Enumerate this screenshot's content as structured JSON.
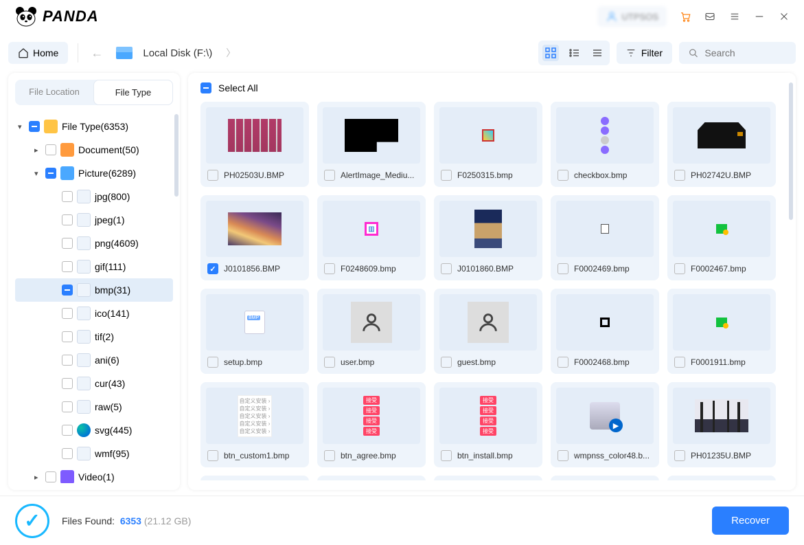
{
  "app": {
    "name": "PANDA",
    "account": "UTPSOS"
  },
  "nav": {
    "home": "Home",
    "crumb": "Local Disk (F:\\)",
    "filter": "Filter",
    "search_ph": "Search"
  },
  "tabs": {
    "loc": "File Location",
    "type": "File Type"
  },
  "tree": [
    {
      "d": 0,
      "exp": "▾",
      "cb": "blue",
      "ico": "folder",
      "label": "File Type(6353)"
    },
    {
      "d": 1,
      "exp": "▸",
      "cb": "",
      "ico": "doc",
      "label": "Document(50)"
    },
    {
      "d": 1,
      "exp": "▾",
      "cb": "blue",
      "ico": "pic",
      "label": "Picture(6289)"
    },
    {
      "d": 2,
      "exp": "",
      "cb": "",
      "ico": "file",
      "label": "jpg(800)"
    },
    {
      "d": 2,
      "exp": "",
      "cb": "",
      "ico": "file",
      "label": "jpeg(1)"
    },
    {
      "d": 2,
      "exp": "",
      "cb": "",
      "ico": "file",
      "label": "png(4609)"
    },
    {
      "d": 2,
      "exp": "",
      "cb": "",
      "ico": "file",
      "label": "gif(111)"
    },
    {
      "d": 2,
      "exp": "",
      "cb": "blue",
      "ico": "file",
      "label": "bmp(31)",
      "sel": true
    },
    {
      "d": 2,
      "exp": "",
      "cb": "",
      "ico": "file",
      "label": "ico(141)"
    },
    {
      "d": 2,
      "exp": "",
      "cb": "",
      "ico": "file",
      "label": "tif(2)"
    },
    {
      "d": 2,
      "exp": "",
      "cb": "",
      "ico": "file",
      "label": "ani(6)"
    },
    {
      "d": 2,
      "exp": "",
      "cb": "",
      "ico": "file",
      "label": "cur(43)"
    },
    {
      "d": 2,
      "exp": "",
      "cb": "",
      "ico": "file",
      "label": "raw(5)"
    },
    {
      "d": 2,
      "exp": "",
      "cb": "",
      "ico": "edge",
      "label": "svg(445)"
    },
    {
      "d": 2,
      "exp": "",
      "cb": "",
      "ico": "file",
      "label": "wmf(95)"
    },
    {
      "d": 1,
      "exp": "▸",
      "cb": "",
      "ico": "vid",
      "label": "Video(1)"
    }
  ],
  "select_all": "Select All",
  "files": [
    {
      "name": "PH02503U.BMP",
      "ck": "",
      "thumb": "buildings"
    },
    {
      "name": "AlertImage_Mediu...",
      "ck": "",
      "thumb": "black"
    },
    {
      "name": "F0250315.bmp",
      "ck": "",
      "thumb": "badge"
    },
    {
      "name": "checkbox.bmp",
      "ck": "",
      "thumb": "dots"
    },
    {
      "name": "PH02742U.BMP",
      "ck": "",
      "thumb": "bag"
    },
    {
      "name": "J0101856.BMP",
      "ck": "checked",
      "thumb": "sky"
    },
    {
      "name": "F0248609.bmp",
      "ck": "",
      "thumb": "pink"
    },
    {
      "name": "J0101860.BMP",
      "ck": "",
      "thumb": "cat"
    },
    {
      "name": "F0002469.bmp",
      "ck": "",
      "thumb": "page"
    },
    {
      "name": "F0002467.bmp",
      "ck": "",
      "thumb": "green1"
    },
    {
      "name": "setup.bmp",
      "ck": "",
      "thumb": "bmp"
    },
    {
      "name": "user.bmp",
      "ck": "",
      "thumb": "user"
    },
    {
      "name": "guest.bmp",
      "ck": "",
      "thumb": "user"
    },
    {
      "name": "F0002468.bmp",
      "ck": "",
      "thumb": "square"
    },
    {
      "name": "F0001911.bmp",
      "ck": "",
      "thumb": "green2"
    },
    {
      "name": "btn_custom1.bmp",
      "ck": "",
      "thumb": "cn1"
    },
    {
      "name": "btn_agree.bmp",
      "ck": "",
      "thumb": "cn2"
    },
    {
      "name": "btn_install.bmp",
      "ck": "",
      "thumb": "cn3"
    },
    {
      "name": "wmpnss_color48.b...",
      "ck": "",
      "thumb": "wmp"
    },
    {
      "name": "PH01235U.BMP",
      "ck": "",
      "thumb": "trees"
    },
    {
      "name": "",
      "ck": "",
      "thumb": "cn4"
    },
    {
      "name": "",
      "ck": "",
      "thumb": "blank"
    },
    {
      "name": "",
      "ck": "",
      "thumb": "blank"
    },
    {
      "name": "",
      "ck": "",
      "thumb": "blank"
    },
    {
      "name": "",
      "ck": "",
      "thumb": "cn5"
    }
  ],
  "footer": {
    "label": "Files Found:",
    "count": "6353",
    "size": "(21.12 GB)",
    "recover": "Recover"
  }
}
